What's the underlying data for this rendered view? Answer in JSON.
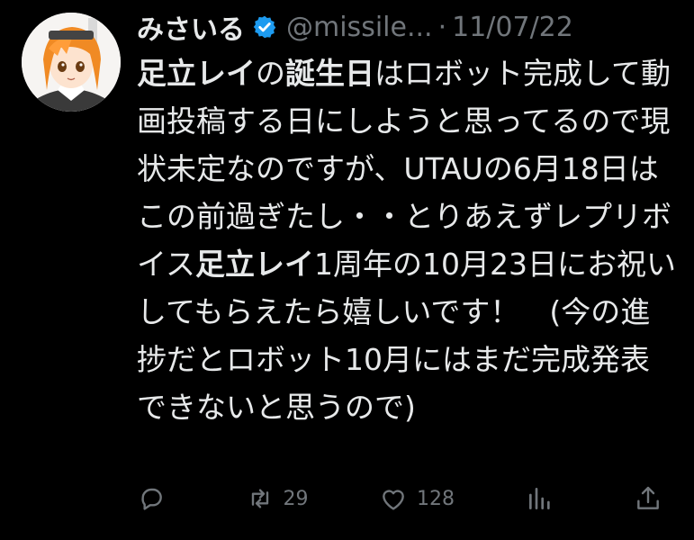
{
  "author": {
    "display_name": "みさいる",
    "handle": "@missile...",
    "separator": "·",
    "date": "11/07/22"
  },
  "tweet": {
    "segments": [
      {
        "text": "足立レイ",
        "bold": true
      },
      {
        "text": "の",
        "bold": false
      },
      {
        "text": "誕生日",
        "bold": true
      },
      {
        "text": "はロボット完成して動画投稿する日にしようと思ってるので現状未定なのですが、UTAUの6月18日はこの前過ぎたし・・とりあえずレプリボイス",
        "bold": false
      },
      {
        "text": "足立レイ",
        "bold": true
      },
      {
        "text": "1周年の10月23日にお祝いしてもらえたら嬉しいです！　(今の進捗だとロボット10月にはまだ完成発表できないと思うので)",
        "bold": false
      }
    ]
  },
  "actions": {
    "reply": {
      "icon": "reply-icon",
      "count": ""
    },
    "retweet": {
      "icon": "retweet-icon",
      "count": "29"
    },
    "like": {
      "icon": "heart-icon",
      "count": "128"
    },
    "views": {
      "icon": "bar-chart-icon",
      "count": ""
    },
    "share": {
      "icon": "share-icon",
      "count": ""
    }
  },
  "colors": {
    "background": "#000000",
    "text": "#e7e9ea",
    "muted": "#71767b",
    "verified": "#1d9bf0"
  }
}
